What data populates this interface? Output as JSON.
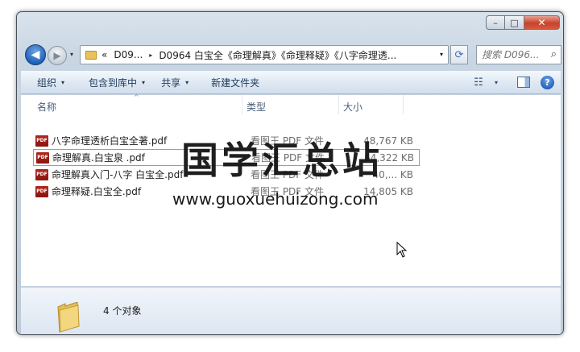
{
  "window": {
    "caption_buttons": {
      "minimize": "–",
      "maximize": "□",
      "close": "✕"
    }
  },
  "nav": {
    "back_glyph": "◀",
    "forward_glyph": "▶",
    "recent_glyph": "▾",
    "address": {
      "overflow": "«",
      "segments": [
        "D09...",
        "D0964 白宝全《命理解真》《命理释疑》《八字命理透..."
      ],
      "separator": "▸",
      "dropdown": "▾"
    },
    "refresh_glyph": "⟳",
    "search_placeholder": "搜索 D096...",
    "search_icon": "⌕"
  },
  "toolbar": {
    "organize": "组织",
    "include_in_library": "包含到库中",
    "share": "共享",
    "new_folder": "新建文件夹",
    "views_icon": "☷",
    "caret": "▾",
    "help_glyph": "?"
  },
  "columns": {
    "name": "名称",
    "type": "类型",
    "size": "大小",
    "sort_glyph": "^"
  },
  "files": [
    {
      "name": "八字命理透析白宝全著.pdf",
      "type": "看图王 PDF 文件",
      "size": "48,767 KB",
      "icon": "pdf-icon",
      "icon_text": "PDF"
    },
    {
      "name": "命理解真.白宝泉 .pdf",
      "type": "看图王 PDF 文件",
      "size": "64,322 KB",
      "icon": "pdf-icon",
      "icon_text": "PDF"
    },
    {
      "name": "命理解真入门-八字 白宝全.pdf",
      "type": "看图王 PDF 文件",
      "size": "40,... KB",
      "icon": "pdf-icon",
      "icon_text": "PDF"
    },
    {
      "name": "命理释疑.白宝全.pdf",
      "type": "看图王 PDF 文件",
      "size": "14,805 KB",
      "icon": "pdf-icon",
      "icon_text": "PDF"
    }
  ],
  "watermark": {
    "chinese": "国学汇总站",
    "url": "www.guoxuehuizong.com"
  },
  "status": {
    "count": "4 个对象"
  },
  "colors": {
    "frame": "#c8d5e2",
    "toolbar_text": "#1e395b",
    "close_red": "#c7432b",
    "selection_border": "#7da2ce",
    "pdf_red": "#b3261e"
  }
}
